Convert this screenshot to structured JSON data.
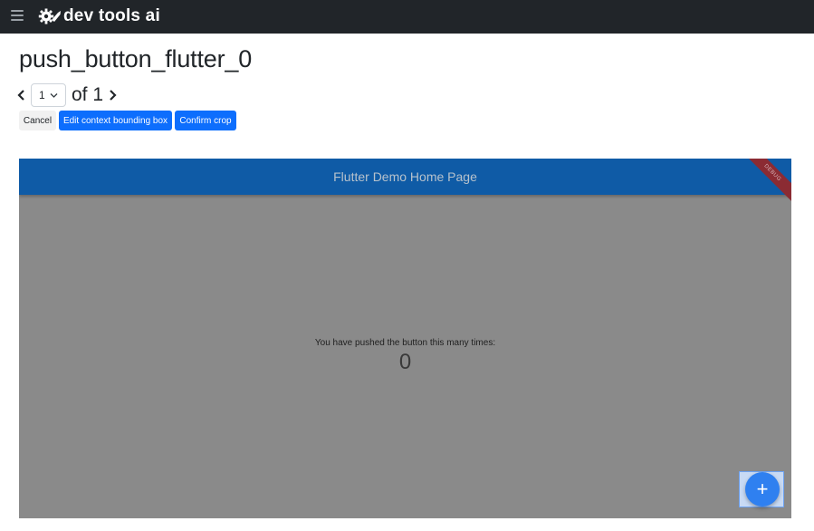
{
  "navbar": {
    "brand": "dev tools ai",
    "menu_icon": "hamburger-menu-icon",
    "logo_icon": "gear-wrench-logo-icon"
  },
  "title": "push_button_flutter_0",
  "pager": {
    "selected_page": "1",
    "of_text": "of 1",
    "prev_icon": "chevron-left-icon",
    "next_icon": "chevron-right-icon"
  },
  "buttons": {
    "cancel": "Cancel",
    "edit_context": "Edit context bounding box",
    "confirm_crop": "Confirm crop"
  },
  "screenshot": {
    "appbar_title": "Flutter Demo Home Page",
    "debug_banner": "DEBUG",
    "counter_text": "You have pushed the button this many times:",
    "counter_value": "0",
    "fab_label": "+"
  },
  "colors": {
    "navbar": "#212529",
    "primary": "#0d6efd",
    "appbar": "#0f5ba6",
    "fab": "#2f80f0"
  }
}
